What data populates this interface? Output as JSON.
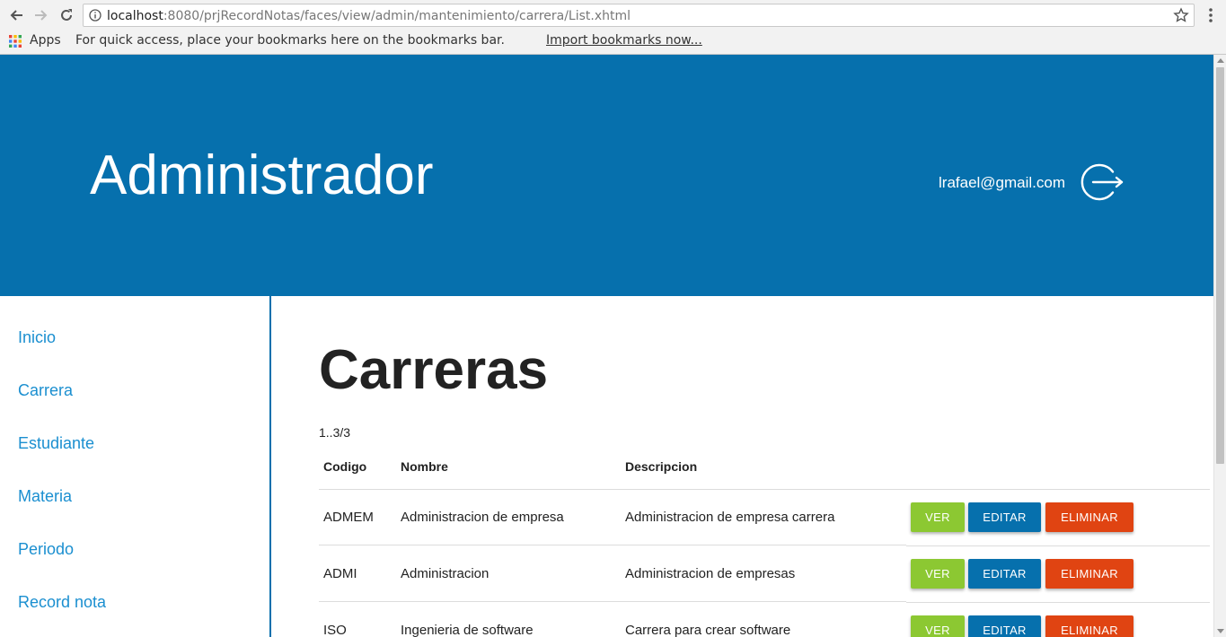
{
  "browser": {
    "url_host": "localhost",
    "url_rest": ":8080/prjRecordNotas/faces/view/admin/mantenimiento/carrera/List.xhtml",
    "apps_label": "Apps",
    "bookmarks_hint": "For quick access, place your bookmarks here on the bookmarks bar.",
    "import_link": "Import bookmarks now...",
    "icons": [
      "back-icon",
      "forward-icon",
      "reload-icon",
      "info-icon",
      "star-icon",
      "menu-icon",
      "apps-icon"
    ]
  },
  "header": {
    "title": "Administrador",
    "email": "lrafael@gmail.com",
    "background": "#0670ad",
    "logout_icon": "logout-icon"
  },
  "sidebar": {
    "items": [
      {
        "label": "Inicio"
      },
      {
        "label": "Carrera"
      },
      {
        "label": "Estudiante"
      },
      {
        "label": "Materia"
      },
      {
        "label": "Periodo"
      },
      {
        "label": "Record nota"
      }
    ],
    "link_color": "#1b8fd0"
  },
  "main": {
    "title": "Carreras",
    "pager": "1..3/3",
    "table": {
      "columns": [
        "Codigo",
        "Nombre",
        "Descripcion"
      ],
      "rows": [
        {
          "codigo": "ADMEM",
          "nombre": "Administracion de empresa",
          "descripcion": "Administracion de empresa carrera"
        },
        {
          "codigo": "ADMI",
          "nombre": "Administracion",
          "descripcion": "Administracion de empresas"
        },
        {
          "codigo": "ISO",
          "nombre": "Ingenieria de software",
          "descripcion": "Carrera para crear software"
        }
      ]
    },
    "actions": {
      "ver": "VER",
      "editar": "EDITAR",
      "eliminar": "ELIMINAR",
      "colors": {
        "ver": "#8cc832",
        "editar": "#0670ad",
        "eliminar": "#e04412"
      }
    }
  }
}
